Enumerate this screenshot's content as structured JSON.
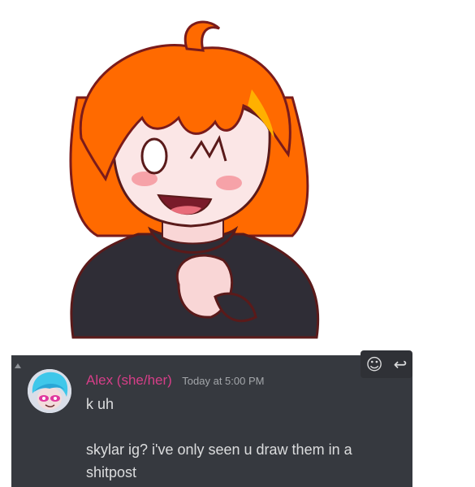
{
  "message": {
    "username": "Alex (she/her)",
    "timestamp": "Today at 5:00 PM",
    "lines": [
      "k uh",
      "skylar ig? i've only seen u draw them in a",
      "shitpost"
    ]
  },
  "toolbar": {
    "react_icon": "add-reaction-icon",
    "reply_icon": "reply-arrow-icon"
  },
  "colors": {
    "chat_background": "#36393f",
    "username": "#d63e88",
    "message_text": "#dcddde",
    "timestamp": "#a3a6aa",
    "hair": "#ff6a00",
    "sweater": "#2f2d36"
  }
}
